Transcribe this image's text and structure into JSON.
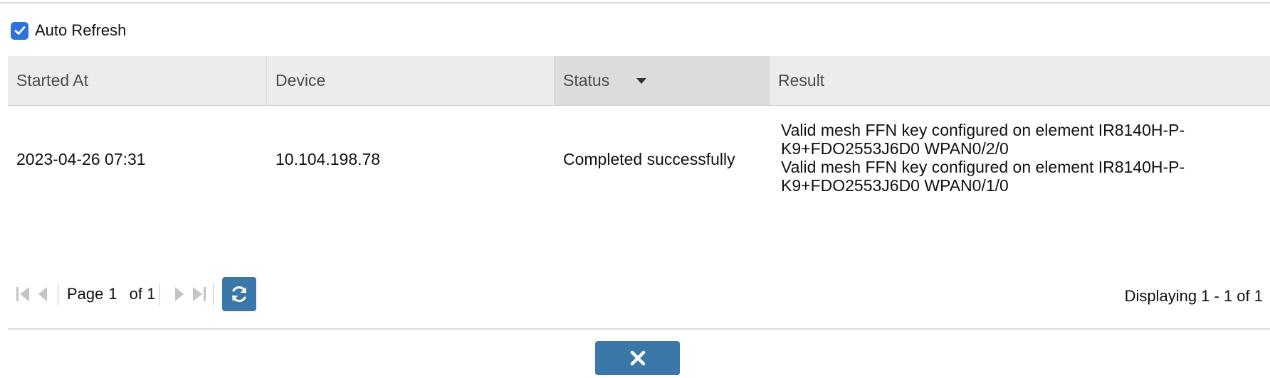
{
  "auto_refresh": {
    "label": "Auto Refresh",
    "checked": true
  },
  "table": {
    "columns": [
      {
        "label": "Started At"
      },
      {
        "label": "Device"
      },
      {
        "label": "Status",
        "sorted": "desc"
      },
      {
        "label": "Result"
      }
    ],
    "rows": [
      {
        "started_at": "2023-04-26 07:31",
        "device": "10.104.198.78",
        "status": "Completed successfully",
        "result": [
          "Valid mesh FFN key configured on element IR8140H-P-K9+FDO2553J6D0 WPAN0/2/0",
          "Valid mesh FFN key configured on element IR8140H-P-K9+FDO2553J6D0 WPAN0/1/0"
        ]
      }
    ]
  },
  "pager": {
    "page_label": "Page",
    "page_value": "1",
    "of_label": "of 1",
    "display_info": "Displaying 1 - 1 of 1"
  },
  "icons": {
    "first": "first-page-icon",
    "prev": "prev-page-icon",
    "next": "next-page-icon",
    "last": "last-page-icon",
    "refresh": "refresh-icon",
    "close": "close-icon",
    "sort": "sort-desc-icon",
    "check": "checkmark-icon"
  },
  "colors": {
    "accent": "#3b77a8",
    "checkbox": "#2f73d8",
    "header_bg": "#ececec",
    "sorted_header_bg": "#dcdcdc"
  }
}
